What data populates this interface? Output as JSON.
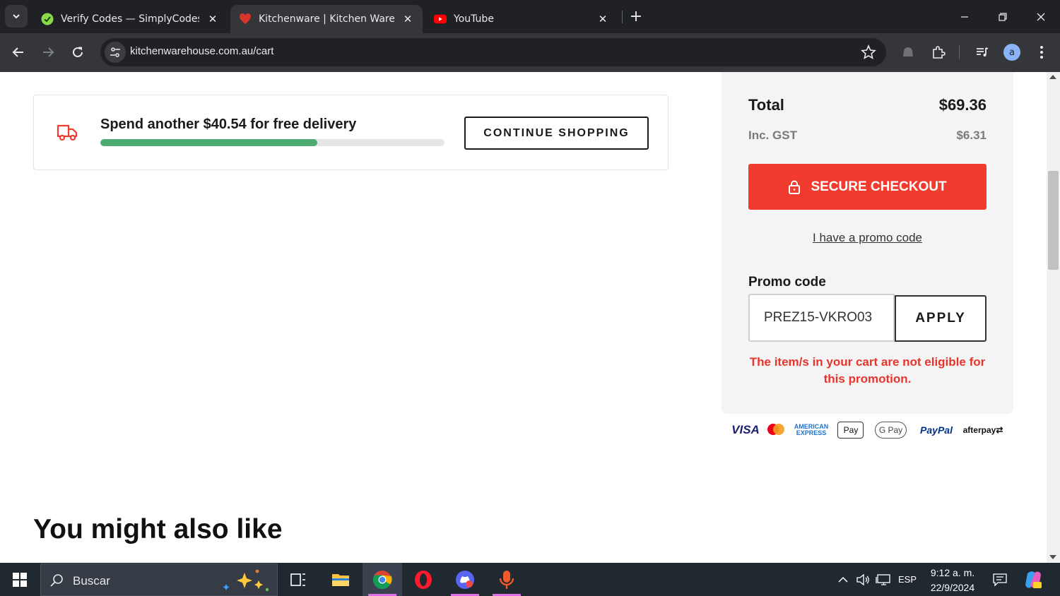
{
  "browser": {
    "tabs": [
      {
        "title": "Verify Codes — SimplyCodes",
        "favicon": "simplycodes-icon",
        "active": false
      },
      {
        "title": "Kitchenware | Kitchen Warehouse",
        "favicon": "kitchen-warehouse-icon",
        "active": true
      },
      {
        "title": "YouTube",
        "favicon": "youtube-icon",
        "active": false
      }
    ],
    "url": "kitchenwarehouse.com.au/cart",
    "profile_initial": "a"
  },
  "delivery": {
    "message": "Spend another $40.54 for free delivery",
    "progress": 0.63,
    "continue_label": "CONTINUE SHOPPING"
  },
  "summary": {
    "total_label": "Total",
    "total_value": "$69.36",
    "gst_label": "Inc. GST",
    "gst_value": "$6.31",
    "checkout_label": "SECURE CHECKOUT",
    "promo_link": "I have a promo code",
    "promo_label": "Promo code",
    "promo_value": "PREZ15-VKRO03",
    "apply_label": "APPLY",
    "promo_error": "The item/s in your cart are not eligible for this promotion."
  },
  "payment_methods": {
    "visa": "VISA",
    "amex_line1": "AMERICAN",
    "amex_line2": "EXPRESS",
    "applepay": "Pay",
    "gpay": "G Pay",
    "paypal": "PayPal",
    "afterpay": "afterpay"
  },
  "recommendations": {
    "heading": "You might also like"
  },
  "taskbar": {
    "search_placeholder": "Buscar",
    "language": "ESP",
    "time": "9:12 a. m.",
    "date": "22/9/2024"
  },
  "colors": {
    "accent_red": "#f23b2f",
    "progress_green": "#4bab73",
    "error_red": "#e8352c"
  }
}
